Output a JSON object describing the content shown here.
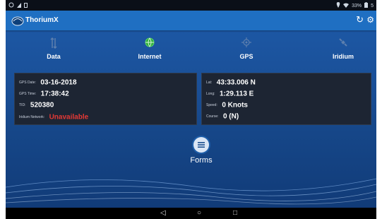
{
  "status_bar": {
    "left_icons": [
      "android-icon",
      "signal-icon",
      "sim-icon"
    ],
    "battery": "33%"
  },
  "app": {
    "title": "ThoriumX",
    "refresh_icon": "refresh-icon",
    "settings_icon": "gear-icon"
  },
  "status_items": [
    {
      "label": "Data",
      "icon": "data-arrows-icon",
      "color": "#5d7fae"
    },
    {
      "label": "Internet",
      "icon": "globe-icon",
      "color": "#5dd66a"
    },
    {
      "label": "GPS",
      "icon": "crosshair-icon",
      "color": "#5d7fae"
    },
    {
      "label": "Iridium",
      "icon": "satellite-icon",
      "color": "#5d7fae"
    }
  ],
  "left_panel": {
    "gps_date": {
      "label": "GPS Date:",
      "value": "03-16-2018"
    },
    "gps_time": {
      "label": "GPS Time:",
      "value": "17:38:42"
    },
    "tid": {
      "label": "TID:",
      "value": "520380"
    },
    "iridium_network": {
      "label": "Iridium Network:",
      "value": "Unavailable",
      "color": "#e53935"
    }
  },
  "right_panel": {
    "lat": {
      "label": "Lat:",
      "value": "43:33.006 N"
    },
    "long": {
      "label": "Long:",
      "value": "1:29.113 E"
    },
    "speed": {
      "label": "Speed:",
      "value": "0 Knots"
    },
    "course": {
      "label": "Course:",
      "value": "0 (N)"
    }
  },
  "forms": {
    "label": "Forms",
    "icon": "list-icon"
  },
  "nav": {
    "back": "◁",
    "home": "○",
    "recents": "□"
  }
}
